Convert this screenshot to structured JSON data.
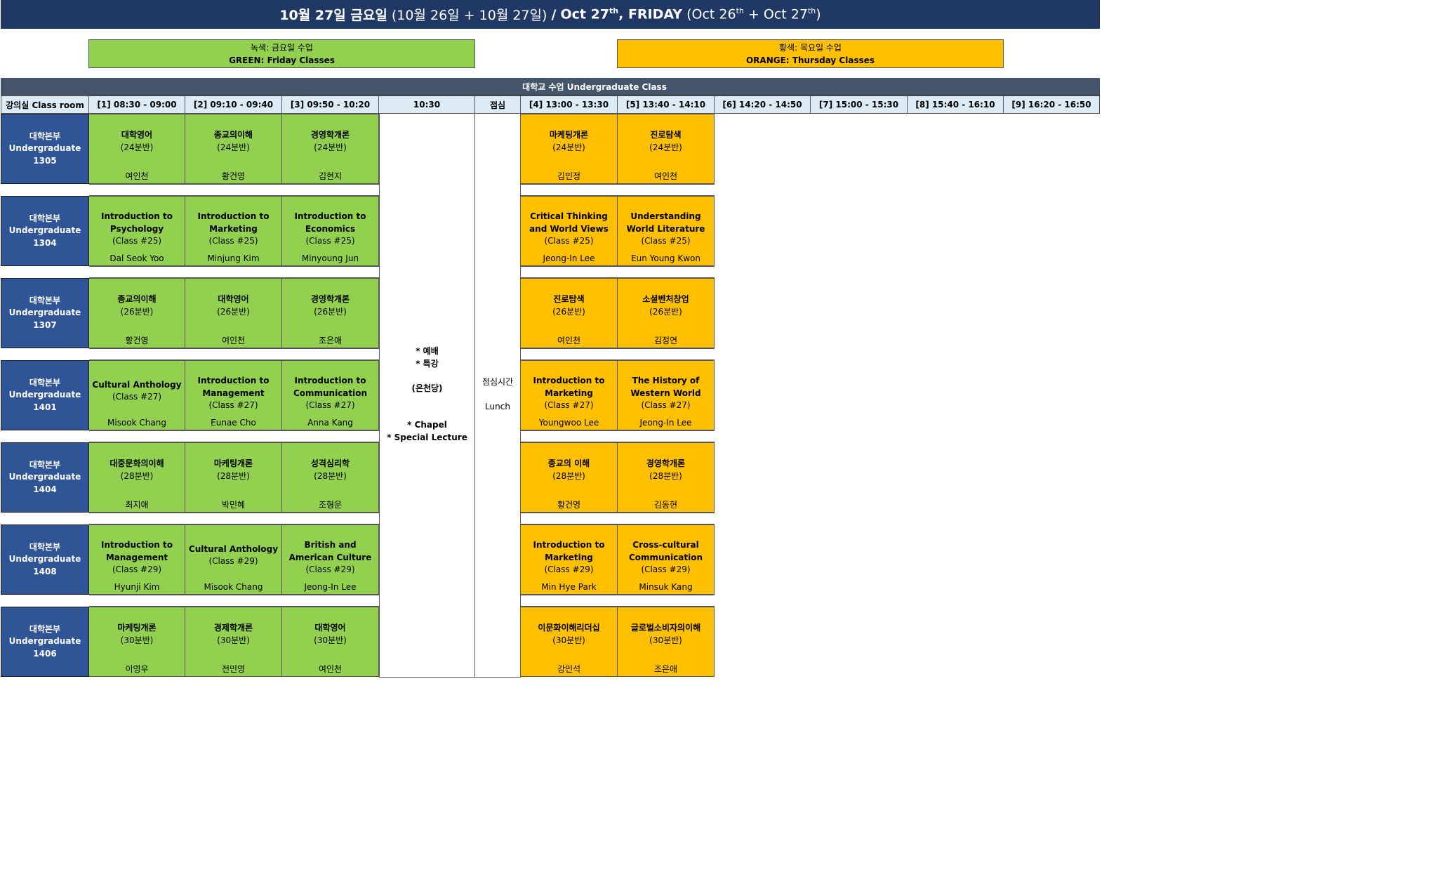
{
  "title": {
    "ko_date": "10월 27일 금요일",
    "ko_range": "(10월 26일 + 10월 27일)",
    "sep": "/",
    "en_main": "Oct 27",
    "en_main_sup": "th",
    "en_day": ", FRIDAY",
    "en_range_a": "(Oct 26",
    "en_range_a_sup": "th",
    "en_range_mid": " + Oct 27",
    "en_range_b_sup": "th",
    "en_range_close": ")"
  },
  "legend": {
    "green": {
      "line1": "녹색: 금요일 수업",
      "line2": "GREEN: Friday Classes",
      "color": "#92d050"
    },
    "orange": {
      "line1": "황색: 목요일 수업",
      "line2": "ORANGE: Thursday Classes",
      "color": "#ffc000"
    }
  },
  "header": {
    "undergrad": "대학교 수업 Undergraduate Class",
    "columns": [
      "강의실 Class room",
      "[1] 08:30 - 09:00",
      "[2] 09:10 - 09:40",
      "[3] 09:50 - 10:20",
      "10:30",
      "점심",
      "[4] 13:00 - 13:30",
      "[5] 13:40 - 14:10",
      "[6] 14:20 - 14:50",
      "[7] 15:00 - 15:30",
      "[8] 15:40 - 16:10",
      "[9] 16:20 - 16:50"
    ]
  },
  "chapel": {
    "l1": "* 예배",
    "l2": "* 특강",
    "l3": "(은천당)",
    "l4": "* Chapel",
    "l5": "* Special Lecture"
  },
  "lunch": {
    "l1": "점심시간",
    "l2": "Lunch"
  },
  "rooms": [
    {
      "line1": "대학본부",
      "line2": "Undergraduate",
      "line3": "1305",
      "cells": [
        {
          "title": "대학영어",
          "sub": "(24분반)",
          "prof": "여인천"
        },
        {
          "title": "종교의이해",
          "sub": "(24분반)",
          "prof": "황건영"
        },
        {
          "title": "경영학개론",
          "sub": "(24분반)",
          "prof": "김현지"
        },
        {
          "title": "마케팅개론",
          "sub": "(24분반)",
          "prof": "김민정"
        },
        {
          "title": "진로탐색",
          "sub": "(24분반)",
          "prof": "여인천"
        }
      ]
    },
    {
      "line1": "대학본부",
      "line2": "Undergraduate",
      "line3": "1304",
      "cells": [
        {
          "title": "Introduction to Psychology",
          "sub": "(Class #25)",
          "prof": "Dal Seok Yoo"
        },
        {
          "title": "Introduction to Marketing",
          "sub": "(Class #25)",
          "prof": "Minjung Kim"
        },
        {
          "title": "Introduction to Economics",
          "sub": "(Class #25)",
          "prof": "Minyoung Jun"
        },
        {
          "title": "Critical Thinking and World Views",
          "sub": "(Class #25)",
          "prof": "Jeong-In Lee"
        },
        {
          "title": "Understanding World Literature",
          "sub": "(Class #25)",
          "prof": "Eun Young Kwon"
        }
      ]
    },
    {
      "line1": "대학본부",
      "line2": "Undergraduate",
      "line3": "1307",
      "cells": [
        {
          "title": "종교의이해",
          "sub": "(26분반)",
          "prof": "황건영"
        },
        {
          "title": "대학영어",
          "sub": "(26분반)",
          "prof": "여인천"
        },
        {
          "title": "경영학개론",
          "sub": "(26분반)",
          "prof": "조은애"
        },
        {
          "title": "진로탐색",
          "sub": "(26분반)",
          "prof": "여인천"
        },
        {
          "title": "소셜벤처창업",
          "sub": "(26분반)",
          "prof": "김정연"
        }
      ]
    },
    {
      "line1": "대학본부",
      "line2": "Undergraduate",
      "line3": "1401",
      "cells": [
        {
          "title": "Cultural Anthology",
          "sub": "(Class #27)",
          "prof": "Misook Chang"
        },
        {
          "title": "Introduction to Management",
          "sub": "(Class #27)",
          "prof": "Eunae Cho"
        },
        {
          "title": "Introduction to Communication",
          "sub": "(Class #27)",
          "prof": "Anna Kang"
        },
        {
          "title": "Introduction to Marketing",
          "sub": "(Class #27)",
          "prof": "Youngwoo Lee"
        },
        {
          "title": "The History of Western World",
          "sub": "(Class #27)",
          "prof": "Jeong-In Lee"
        }
      ]
    },
    {
      "line1": "대학본부",
      "line2": "Undergraduate",
      "line3": "1404",
      "cells": [
        {
          "title": "대중문화의이해",
          "sub": "(28분반)",
          "prof": "최지애"
        },
        {
          "title": "마케팅개론",
          "sub": "(28분반)",
          "prof": "박민혜"
        },
        {
          "title": "성격심리학",
          "sub": "(28분반)",
          "prof": "조형운"
        },
        {
          "title": "종교의 이해",
          "sub": "(28분반)",
          "prof": "황건영"
        },
        {
          "title": "경영학개론",
          "sub": "(28분반)",
          "prof": "김동현"
        }
      ]
    },
    {
      "line1": "대학본부",
      "line2": "Undergraduate",
      "line3": "1408",
      "cells": [
        {
          "title": "Introduction to Management",
          "sub": "(Class #29)",
          "prof": "Hyunji Kim"
        },
        {
          "title": "Cultural Anthology",
          "sub": "(Class #29)",
          "prof": "Misook Chang"
        },
        {
          "title": "British and American Culture",
          "sub": "(Class #29)",
          "prof": "Jeong-In Lee"
        },
        {
          "title": "Introduction to Marketing",
          "sub": "(Class #29)",
          "prof": "Min Hye Park"
        },
        {
          "title": "Cross-cultural Communication",
          "sub": "(Class #29)",
          "prof": "Minsuk Kang"
        }
      ]
    },
    {
      "line1": "대학본부",
      "line2": "Undergraduate",
      "line3": "1406",
      "cells": [
        {
          "title": "마케팅개론",
          "sub": "(30분반)",
          "prof": "이영우"
        },
        {
          "title": "경제학개론",
          "sub": "(30분반)",
          "prof": "전민영"
        },
        {
          "title": "대학영어",
          "sub": "(30분반)",
          "prof": "여인천"
        },
        {
          "title": "이문화이해리더십",
          "sub": "(30분반)",
          "prof": "강민석"
        },
        {
          "title": "글로벌소비자의이해",
          "sub": "(30분반)",
          "prof": "조은애"
        }
      ]
    }
  ]
}
